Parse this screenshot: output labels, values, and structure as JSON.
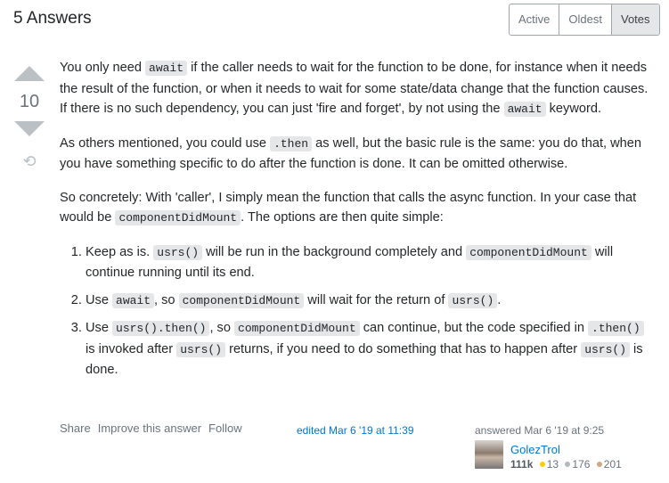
{
  "header": {
    "title": "5 Answers",
    "sort_tabs": [
      "Active",
      "Oldest",
      "Votes"
    ],
    "active_tab": "Votes"
  },
  "vote": {
    "count": "10",
    "upvote_icon": "triangle-up-icon",
    "downvote_icon": "triangle-down-icon",
    "history_icon": "history-icon"
  },
  "paragraphs": [
    [
      {
        "t": "You only need "
      },
      {
        "t": "await",
        "code": true
      },
      {
        "t": " if the caller needs to wait for the function to be done, for instance when it needs the result of the function, or when it needs to wait for some state/data change that the function causes. If there is no such dependency, you can just 'fire and forget', by not using the "
      },
      {
        "t": "await",
        "code": true
      },
      {
        "t": " keyword."
      }
    ],
    [
      {
        "t": "As others mentioned, you could use "
      },
      {
        "t": ".then",
        "code": true
      },
      {
        "t": " as well, but the basic rule is the same: you do that, when you have something specific to do after the function is done. It can be omitted otherwise."
      }
    ],
    [
      {
        "t": "So concretely: With 'caller', I simply mean the function that calls the async function. In your case that would be "
      },
      {
        "t": "componentDidMount",
        "code": true
      },
      {
        "t": ". The options are then quite simple:"
      }
    ]
  ],
  "list": [
    [
      {
        "t": "Keep as is. "
      },
      {
        "t": "usrs()",
        "code": true
      },
      {
        "t": " will be run in the background completely and "
      },
      {
        "t": "componentDidMount",
        "code": true
      },
      {
        "t": " will continue running until its end."
      }
    ],
    [
      {
        "t": "Use "
      },
      {
        "t": "await",
        "code": true
      },
      {
        "t": ", so "
      },
      {
        "t": "componentDidMount",
        "code": true
      },
      {
        "t": " will wait for the return of "
      },
      {
        "t": "usrs()",
        "code": true
      },
      {
        "t": "."
      }
    ],
    [
      {
        "t": "Use "
      },
      {
        "t": "usrs().then()",
        "code": true
      },
      {
        "t": ", so "
      },
      {
        "t": "componentDidMount",
        "code": true
      },
      {
        "t": " can continue, but the code specified in "
      },
      {
        "t": ".then()",
        "code": true
      },
      {
        "t": " is invoked after "
      },
      {
        "t": "usrs()",
        "code": true
      },
      {
        "t": " returns, if you need to do something that has to happen after "
      },
      {
        "t": "usrs()",
        "code": true
      },
      {
        "t": " is done."
      }
    ]
  ],
  "post_menu": [
    "Share",
    "Improve this answer",
    "Follow"
  ],
  "edited": "edited Mar 6 '19 at 11:39",
  "answered": "answered Mar 6 '19 at 9:25",
  "user": {
    "name": "GolezTrol",
    "reputation": "111k",
    "gold": "13",
    "silver": "176",
    "bronze": "201"
  },
  "colors": {
    "gold": "#ffcc01",
    "silver": "#b4b8bc",
    "bronze": "#d1a684",
    "link": "#0077cc"
  }
}
